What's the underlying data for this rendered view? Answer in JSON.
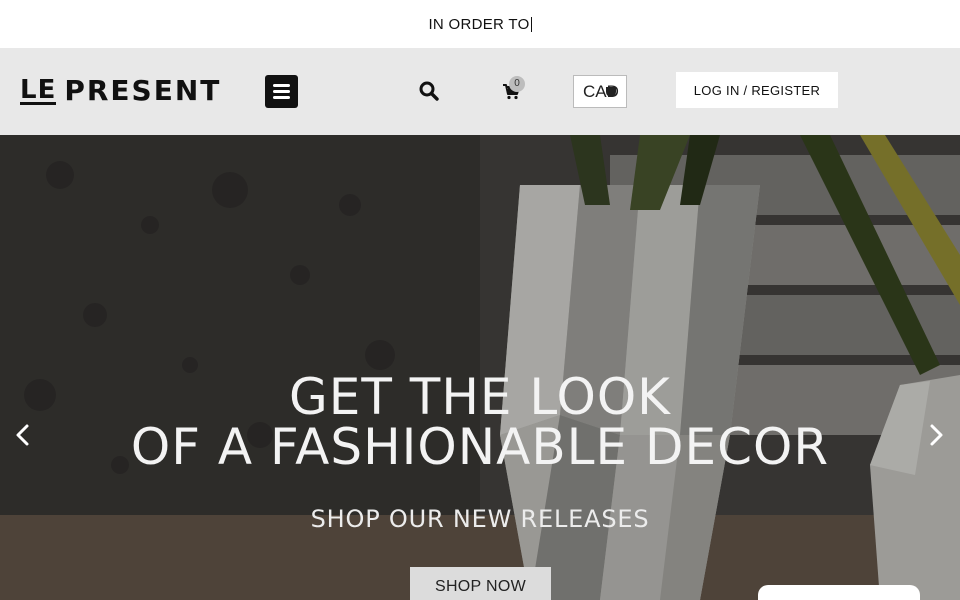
{
  "announcement": {
    "text": "IN ORDER TO"
  },
  "header": {
    "logo_left": "LE",
    "logo_main": "PRESENT",
    "menu_icon": "hamburger-icon",
    "search_icon": "search-icon",
    "cart_icon": "cart-icon",
    "cart_count": "0",
    "currency": "CAD",
    "login_label": "LOG IN / REGISTER"
  },
  "hero": {
    "title_line1": "GET THE LOOK",
    "title_line2": "OF A FASHIONABLE DECOR",
    "subtitle": "SHOP OUR NEW RELEASES",
    "cta_label": "SHOP NOW",
    "prev_icon": "chevron-left-icon",
    "next_icon": "chevron-right-icon"
  },
  "colors": {
    "header_bg": "#e8e8e8",
    "hero_text": "#f3f3f3",
    "button_bg": "#dcdcdc",
    "dark": "#111111"
  }
}
